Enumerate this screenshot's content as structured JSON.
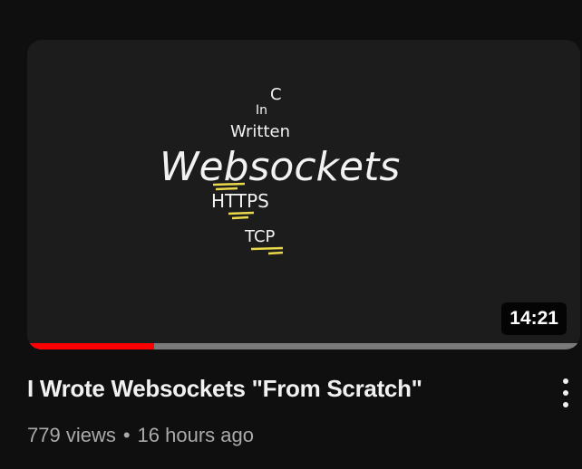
{
  "video": {
    "title": "I Wrote Websockets \"From Scratch\"",
    "duration": "14:21",
    "views": "779 views",
    "separator": "•",
    "age": "16 hours ago",
    "watch_progress": 0.23
  },
  "thumbnail": {
    "words": [
      "C",
      "In",
      "Written",
      "Websockets",
      "HTTPS",
      "TCP"
    ]
  },
  "colors": {
    "progress_played": "#ff0000",
    "progress_track": "#7a7a7a",
    "chalk_underline": "#e8d84a"
  },
  "icons": {
    "menu": "more-vert-icon"
  }
}
